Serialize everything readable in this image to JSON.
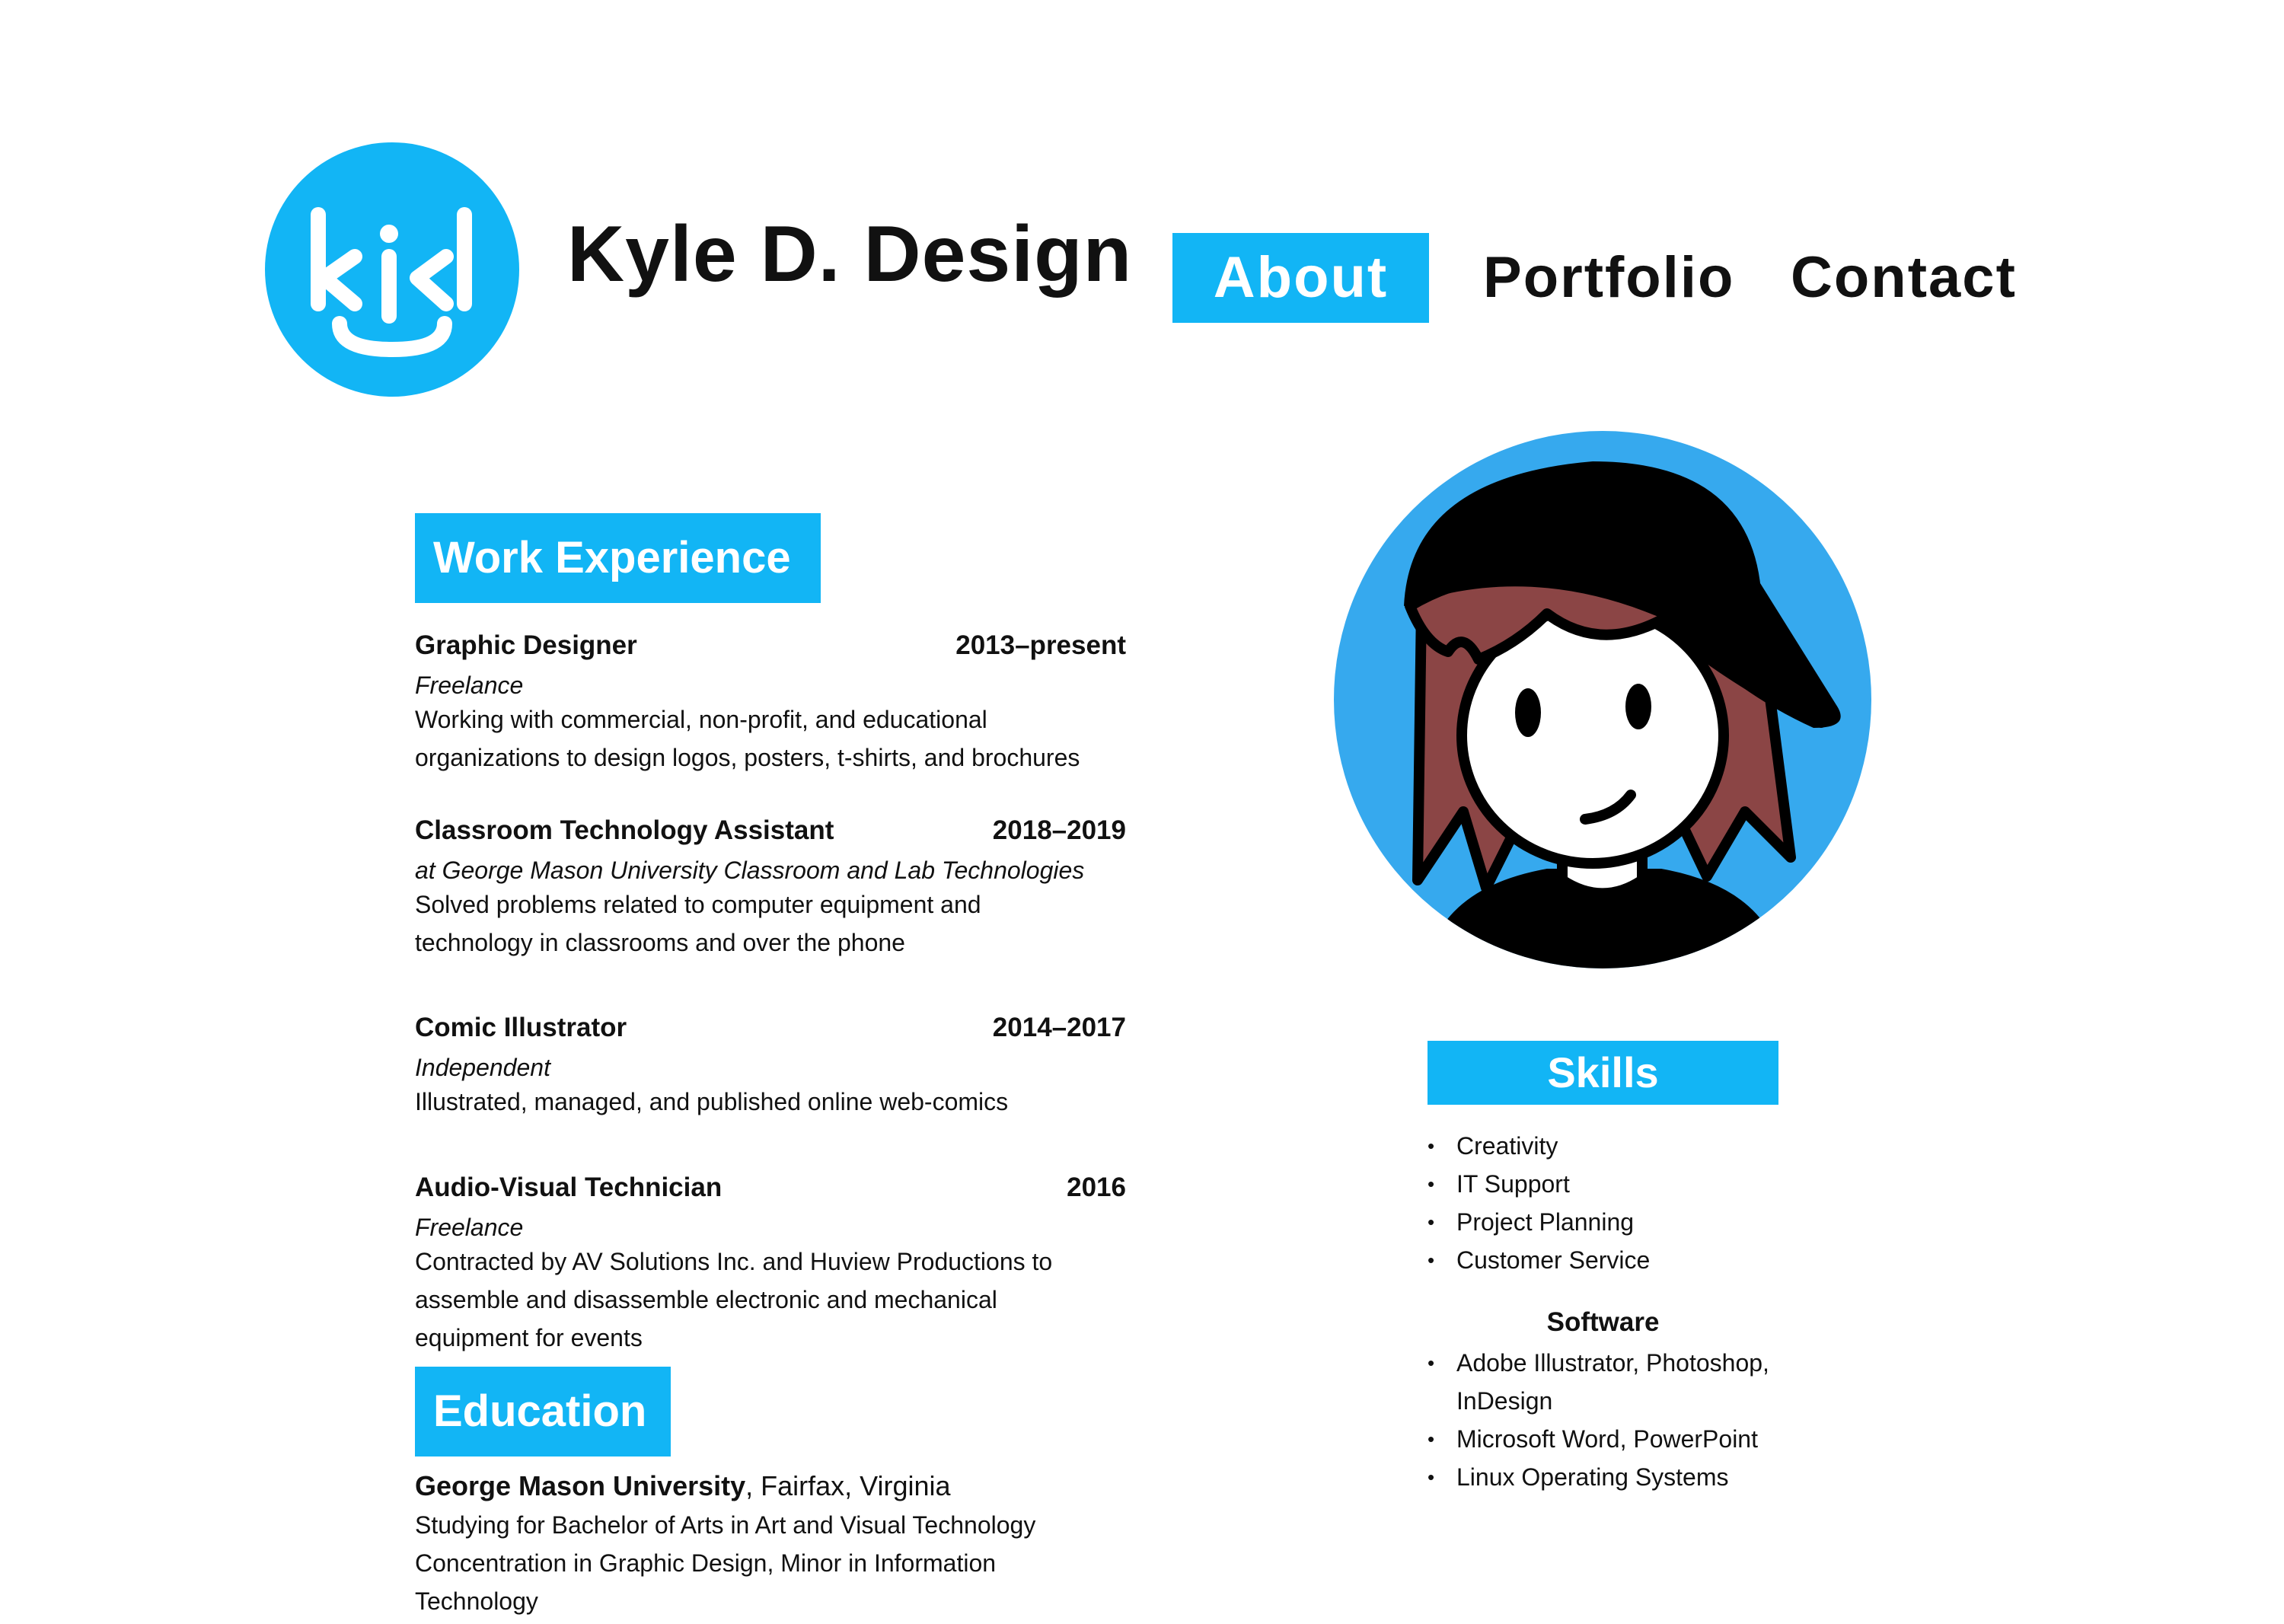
{
  "colors": {
    "accent": "#12b5f5",
    "text": "#111111",
    "avatar_bg": "#36a9ee",
    "hair": "#8b4545"
  },
  "logo": {
    "text": "kjd",
    "icon": "kjd-smile-logo"
  },
  "header": {
    "title": "Kyle D. Design"
  },
  "nav": [
    {
      "label": "About",
      "active": true
    },
    {
      "label": "Portfolio",
      "active": false
    },
    {
      "label": "Contact",
      "active": false
    }
  ],
  "work": {
    "heading": "Work Experience",
    "jobs": [
      {
        "title": "Graphic Designer",
        "years": "2013–present",
        "org": "Freelance",
        "description": "Working with commercial, non-profit, and educational organizations to design logos, posters, t-shirts, and brochures"
      },
      {
        "title": "Classroom Technology Assistant",
        "years": "2018–2019",
        "org": "at George Mason University Classroom and Lab Technologies",
        "description": "Solved problems related to computer equipment and technology in classrooms and over the phone"
      },
      {
        "title": "Comic Illustrator",
        "years": "2014–2017",
        "org": "Independent",
        "description": "Illustrated, managed, and published online web-comics"
      },
      {
        "title": "Audio-Visual Technician",
        "years": "2016",
        "org": "Freelance",
        "description": "Contracted by AV Solutions Inc. and Huview Productions to assemble and disassemble electronic and mechanical equipment for events"
      }
    ]
  },
  "education": {
    "heading": "Education",
    "school": "George Mason University",
    "location": ", Fairfax, Virginia",
    "description": "Studying for Bachelor of Arts in Art and Visual Technology Concentration in Graphic Design, Minor in Information Technology"
  },
  "skills": {
    "heading": "Skills",
    "items": [
      "Creativity",
      "IT Support",
      "Project Planning",
      "Customer Service"
    ],
    "software_title": "Software",
    "software": [
      "Adobe Illustrator, Photoshop, InDesign",
      "Microsoft Word, PowerPoint",
      "Linux Operating Systems"
    ]
  }
}
